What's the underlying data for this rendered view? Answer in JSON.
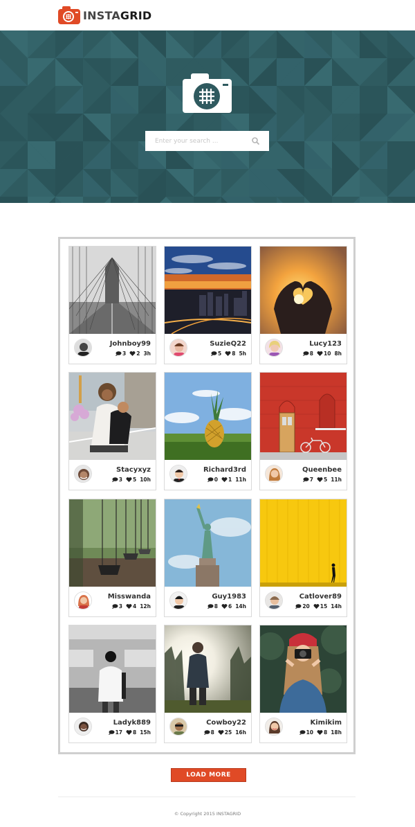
{
  "brand": {
    "name_part1": "INSTA",
    "name_part2": "GRID",
    "accent_color": "#e04a26",
    "hero_color": "#2f5a5f"
  },
  "search": {
    "placeholder": "Enter your search ...",
    "icon": "search-icon"
  },
  "posts": [
    {
      "user": "Johnboy99",
      "comments": "3",
      "likes": "2",
      "time": "3h"
    },
    {
      "user": "SuzieQ22",
      "comments": "5",
      "likes": "8",
      "time": "5h"
    },
    {
      "user": "Lucy123",
      "comments": "8",
      "likes": "10",
      "time": "8h"
    },
    {
      "user": "Stacyxyz",
      "comments": "3",
      "likes": "5",
      "time": "10h"
    },
    {
      "user": "Richard3rd",
      "comments": "0",
      "likes": "1",
      "time": "11h"
    },
    {
      "user": "Queenbee",
      "comments": "7",
      "likes": "5",
      "time": "11h"
    },
    {
      "user": "Misswanda",
      "comments": "3",
      "likes": "4",
      "time": "12h"
    },
    {
      "user": "Guy1983",
      "comments": "8",
      "likes": "6",
      "time": "14h"
    },
    {
      "user": "Catlover89",
      "comments": "20",
      "likes": "15",
      "time": "14h"
    },
    {
      "user": "Ladyk889",
      "comments": "17",
      "likes": "8",
      "time": "15h"
    },
    {
      "user": "Cowboy22",
      "comments": "8",
      "likes": "25",
      "time": "16h"
    },
    {
      "user": "Kimikim",
      "comments": "10",
      "likes": "8",
      "time": "18h"
    }
  ],
  "load_more_label": "LOAD MORE",
  "copyright": "© Copyright 2015 INSTAGRID"
}
